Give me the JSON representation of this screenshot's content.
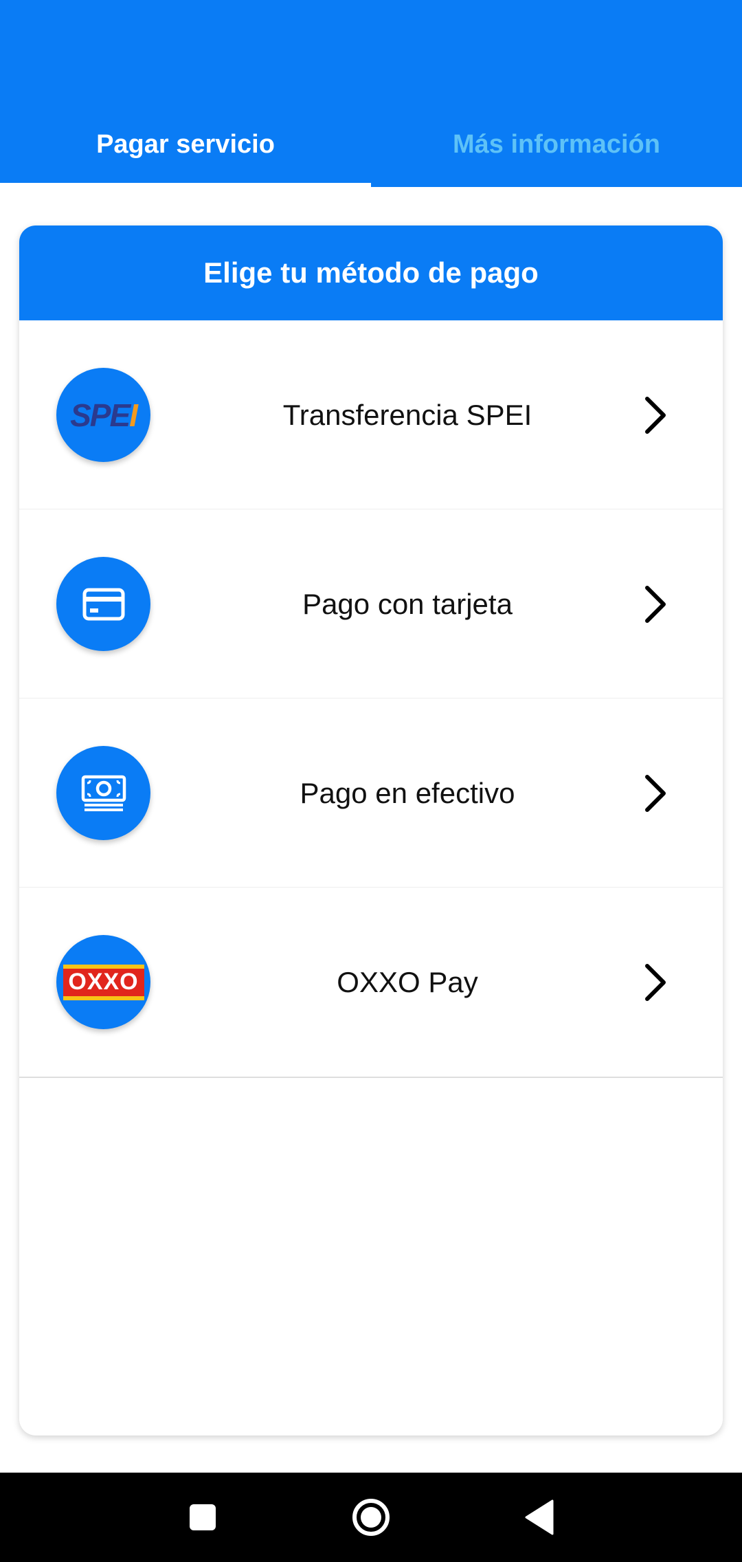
{
  "tabs": {
    "active": "Pagar servicio",
    "inactive": "Más información"
  },
  "card": {
    "title": "Elige tu método de pago",
    "methods": [
      {
        "label": "Transferencia SPEI",
        "icon": "spei-logo-icon",
        "logo_text_main": "SPE",
        "logo_text_accent": "I"
      },
      {
        "label": "Pago con tarjeta",
        "icon": "credit-card-icon"
      },
      {
        "label": "Pago en efectivo",
        "icon": "cash-icon"
      },
      {
        "label": "OXXO Pay",
        "icon": "oxxo-logo-icon",
        "logo_text": "OXXO"
      }
    ]
  },
  "colors": {
    "primary": "#0A7CF5",
    "tab_inactive": "#5EC2F7",
    "navbar": "#000000"
  },
  "navbar": {
    "buttons": [
      "recent-apps-icon",
      "home-icon",
      "back-icon"
    ]
  }
}
